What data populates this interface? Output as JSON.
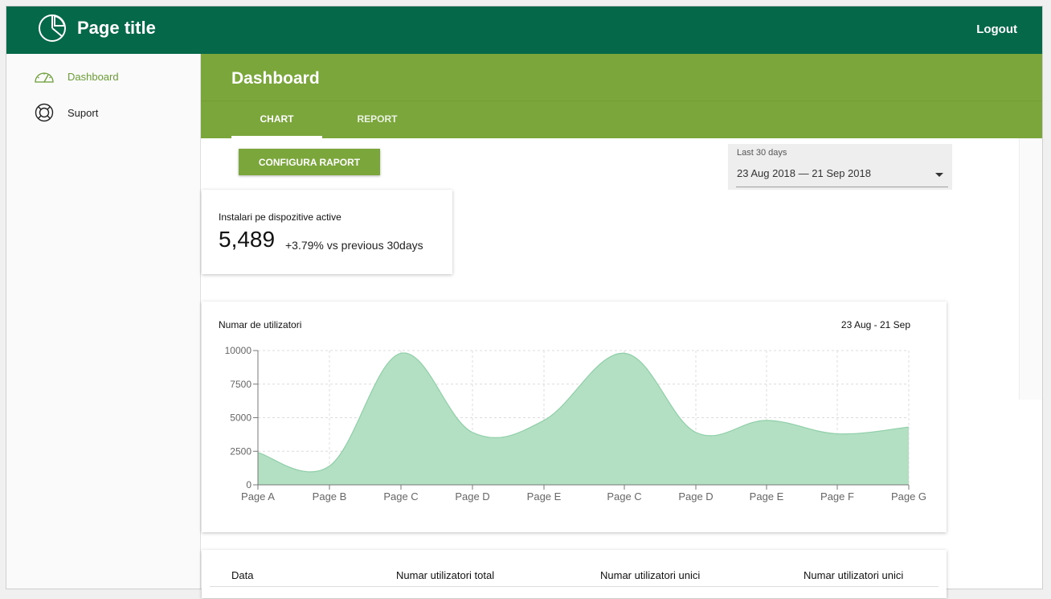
{
  "topbar": {
    "title": "Page title",
    "logout_label": "Logout"
  },
  "sidebar": {
    "items": [
      {
        "label": "Dashboard",
        "icon": "speedometer-icon",
        "active": true
      },
      {
        "label": "Suport",
        "icon": "lifebuoy-icon",
        "active": false
      }
    ]
  },
  "header": {
    "title": "Dashboard",
    "tabs": [
      {
        "label": "CHART",
        "active": true
      },
      {
        "label": "REPORT",
        "active": false
      }
    ]
  },
  "toolbar": {
    "configure_label": "CONFIGURA RAPORT",
    "date_filter": {
      "label": "Last 30 days",
      "value": "23 Aug 2018 — 21 Sep 2018"
    }
  },
  "stat": {
    "label": "Instalari pe dispozitive active",
    "value": "5,489",
    "delta": "+3.79% vs previous 30days"
  },
  "chart_card": {
    "title": "Numar de utilizatori",
    "range": "23 Aug - 21 Sep"
  },
  "chart_data": {
    "type": "area",
    "categories": [
      "Page A",
      "Page B",
      "Page C",
      "Page D",
      "Page E",
      "Page C",
      "Page D",
      "Page E",
      "Page F",
      "Page G"
    ],
    "values": [
      2400,
      1398,
      9800,
      3908,
      4800,
      9800,
      3908,
      4800,
      3800,
      4300
    ],
    "y_ticks": [
      0,
      2500,
      5000,
      7500,
      10000
    ],
    "ylim": [
      0,
      10000
    ],
    "grid": true,
    "colors": {
      "fill": "#b3dfc3",
      "stroke": "#8fcfa8"
    }
  },
  "table": {
    "headers": [
      "Data",
      "Numar utilizatori total",
      "Numar utilizatori unici",
      "Numar utilizatori unici"
    ]
  },
  "colors": {
    "topbar": "#046849",
    "accent": "#7aa63b",
    "active_nav": "#6a9d35"
  }
}
